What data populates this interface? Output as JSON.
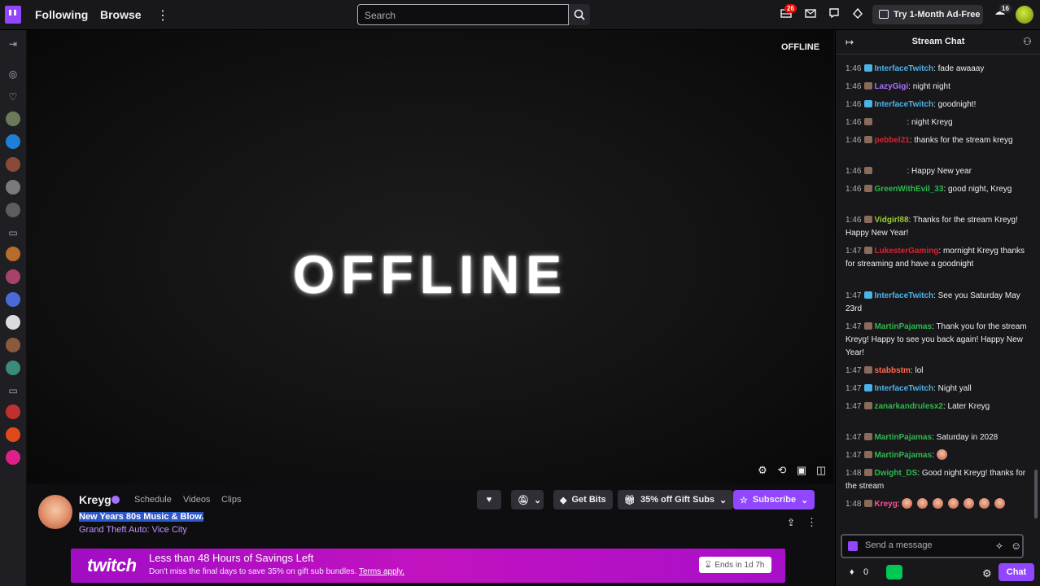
{
  "topnav": {
    "following": "Following",
    "browse": "Browse",
    "search_placeholder": "Search",
    "notifications_count": "26",
    "prime_count": "16",
    "ad_free": "Try 1-Month Ad-Free"
  },
  "player": {
    "offline_big": "OFFLINE",
    "offline_tag": "OFFLINE"
  },
  "channel": {
    "name": "Kreyg",
    "tabs": [
      "Schedule",
      "Videos",
      "Clips"
    ],
    "stream_title": "New Years 80s Music & Blow.",
    "game": "Grand Theft Auto: Vice City",
    "get_bits": "Get Bits",
    "gift_subs": "35% off Gift Subs",
    "subscribe": "Subscribe"
  },
  "banner": {
    "logo": "twitch",
    "title": "Less than 48 Hours of Savings Left",
    "subtitle": "Don't miss the final days to save 35% on gift sub bundles.",
    "terms": "Terms apply.",
    "timer": "Ends in 1d 7h"
  },
  "chat": {
    "title": "Stream Chat",
    "input_placeholder": "Send a message",
    "points": "0",
    "chat_button": "Chat",
    "messages": [
      {
        "time": "1:46",
        "user": "InterfaceTwitch",
        "color": "#4bb3e8",
        "text": "fade awaaay"
      },
      {
        "time": "1:46",
        "user": "LazyGigi",
        "color": "#a970ff",
        "text": "night night"
      },
      {
        "time": "1:46",
        "user": "InterfaceTwitch",
        "color": "#4bb3e8",
        "text": "goodnight!"
      },
      {
        "time": "1:46",
        "user": "",
        "color": "#c9212b",
        "text": "night Kreyg"
      },
      {
        "time": "1:46",
        "user": "pebbel21",
        "color": "#e0202d",
        "text": "thanks for the stream kreyg"
      },
      {
        "time": "1:46",
        "user": "",
        "color": "#c9212b",
        "text": "Happy New year"
      },
      {
        "time": "1:46",
        "user": "GreenWithEvil_33",
        "color": "#2eb84b",
        "text": "good night, Kreyg"
      },
      {
        "time": "1:46",
        "user": "Vidgirl88",
        "color": "#9acd32",
        "text": "Thanks for the stream Kreyg! Happy New Year!"
      },
      {
        "time": "1:47",
        "user": "LukesterGaming",
        "color": "#e0202d",
        "text": "mornight Kreyg  thanks for streaming and have a goodnight"
      },
      {
        "time": "1:47",
        "user": "InterfaceTwitch",
        "color": "#4bb3e8",
        "text": "See you Saturday May 23rd"
      },
      {
        "time": "1:47",
        "user": "MartinPajamas",
        "color": "#2eb84b",
        "text": "Thank you for the stream Kreyg! Happy to see you back again! Happy New Year!"
      },
      {
        "time": "1:47",
        "user": "stabbstm",
        "color": "#ff6a4d",
        "text": "lol"
      },
      {
        "time": "1:47",
        "user": "InterfaceTwitch",
        "color": "#4bb3e8",
        "text": "Night yall"
      },
      {
        "time": "1:47",
        "user": "zanarkandrulesx2",
        "color": "#2eb84b",
        "text": "Later Kreyg"
      },
      {
        "time": "1:47",
        "user": "MartinPajamas",
        "color": "#2eb84b",
        "text": "Saturday in 2028"
      },
      {
        "time": "1:47",
        "user": "MartinPajamas",
        "color": "#2eb84b",
        "text": ""
      },
      {
        "time": "1:48",
        "user": "Dwight_DS",
        "color": "#2eb84b",
        "text": "Good night Kreyg! thanks for the stream"
      },
      {
        "time": "1:48",
        "user": "Kreyg",
        "color": "#ff4f9a",
        "text": ""
      }
    ]
  }
}
